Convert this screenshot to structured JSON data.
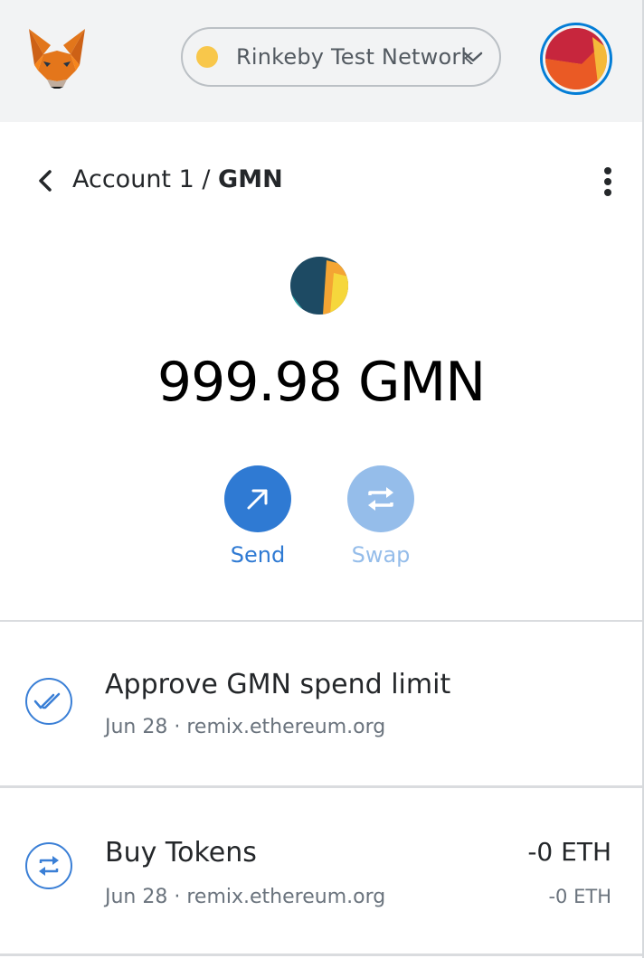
{
  "network": {
    "name": "Rinkeby Test Network",
    "dot_color": "#f8c74b"
  },
  "header": {
    "account": "Account 1",
    "separator": " / ",
    "token": "GMN"
  },
  "balance": {
    "amount": "999.98",
    "symbol": "GMN"
  },
  "actions": [
    {
      "label": "Send",
      "icon": "arrow-up-right-icon",
      "color": "#2f7ad3",
      "enabled": true
    },
    {
      "label": "Swap",
      "icon": "swap-arrows-icon",
      "color": "#95bdea",
      "enabled": false
    }
  ],
  "transactions": [
    {
      "title": "Approve GMN spend limit",
      "date": "Jun 28",
      "dot": " · ",
      "origin": "remix.ethereum.org",
      "icon": "double-check-icon",
      "primary_amount": "",
      "secondary_amount": ""
    },
    {
      "title": "Buy Tokens",
      "date": "Jun 28",
      "dot": " · ",
      "origin": "remix.ethereum.org",
      "icon": "swap-arrows-icon",
      "primary_amount": "-0 ETH",
      "secondary_amount": "-0 ETH"
    }
  ]
}
